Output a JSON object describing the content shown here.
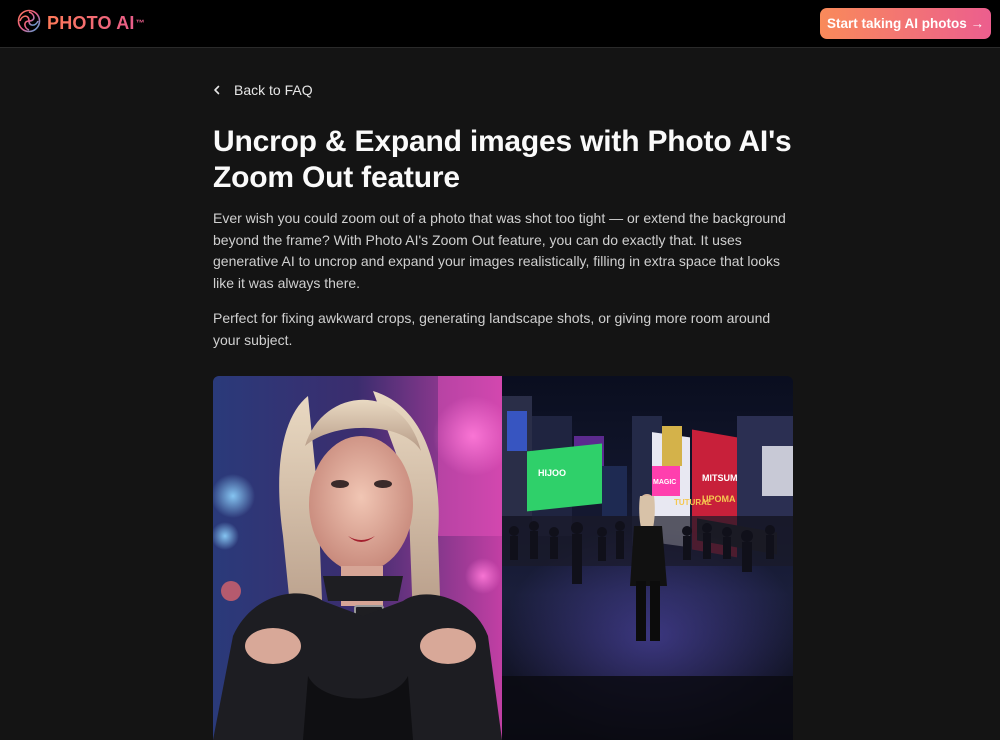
{
  "header": {
    "brand_name": "PHOTO AI",
    "brand_tm": "™",
    "cta_label": "Start taking AI photos →"
  },
  "nav": {
    "back_label": "Back to FAQ"
  },
  "article": {
    "title": "Uncrop & Expand images with Photo AI's Zoom Out feature",
    "paragraph_1": "Ever wish you could zoom out of a photo that was shot too tight — or extend the background beyond the frame? With Photo AI's Zoom Out feature, you can do exactly that. It uses generative AI to uncrop and expand your images realistically, filling in extra space that looks like it was always there.",
    "paragraph_2": "Perfect for fixing awkward crops, generating landscape shots, or giving more room around your subject."
  },
  "gallery": {
    "left_image": "portrait-closeup-neon",
    "right_image": "zoomed-out-times-square",
    "billboards": [
      "MITSUMA",
      "TUTURAL",
      "UPOMA",
      "HIJOO",
      "MAGIC"
    ]
  },
  "colors": {
    "accent_start": "#f98a5a",
    "accent_end": "#ec5e8e",
    "background": "#141414",
    "topbar": "#000000"
  }
}
